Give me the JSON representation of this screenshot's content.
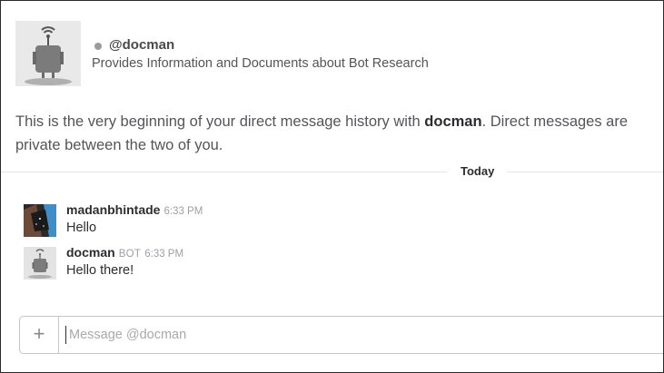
{
  "intro": {
    "handle": "@docman",
    "purpose": "Provides Information and Documents about Bot Research",
    "text_before": "This is the very beginning of your direct message history with ",
    "bot_name": "docman",
    "text_after": ". Direct messages are private between the two of you."
  },
  "divider": {
    "label": "Today"
  },
  "messages": [
    {
      "author": "madanbhintade",
      "time": "6:33 PM",
      "text": "Hello",
      "avatar": "user-avatar-icon"
    },
    {
      "author": "docman",
      "tag": "BOT",
      "time": "6:33 PM",
      "text": "Hello there!",
      "avatar": "robot-icon"
    }
  ],
  "composer": {
    "placeholder": "Message @docman",
    "plus_icon": "plus-icon"
  },
  "colors": {
    "status_dot": "#9b9b9b",
    "text": "#2c2d30",
    "muted": "#9e9ea6"
  }
}
